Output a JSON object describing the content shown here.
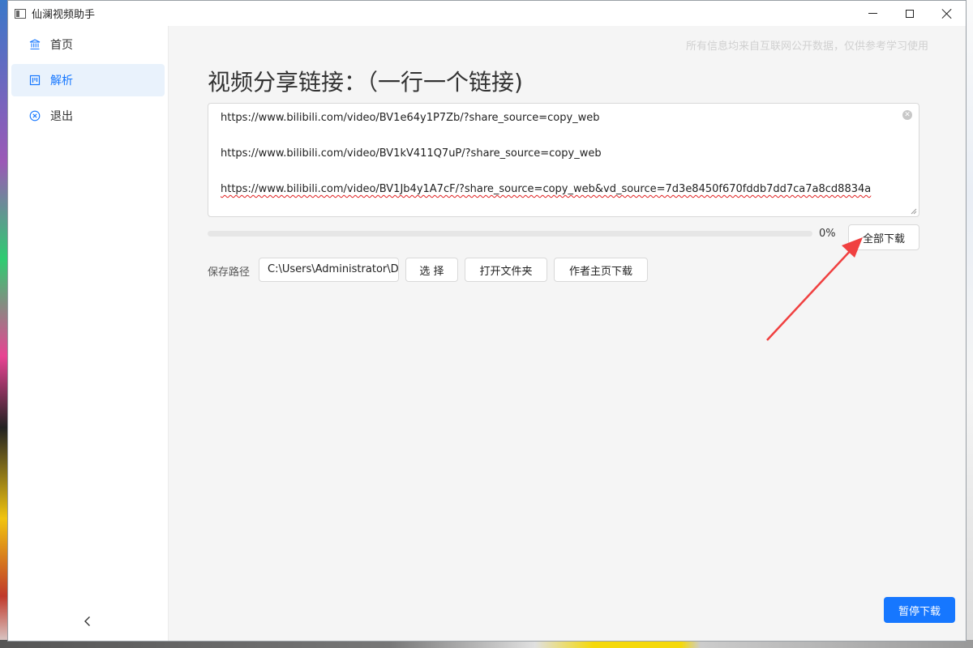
{
  "window": {
    "title": "仙澜视频助手"
  },
  "sidebar": {
    "items": [
      {
        "label": "首页",
        "icon": "bank-icon",
        "active": false
      },
      {
        "label": "解析",
        "icon": "project-icon",
        "active": true
      },
      {
        "label": "退出",
        "icon": "close-circle-icon",
        "active": false
      }
    ],
    "collapse_icon": "chevron-left-icon"
  },
  "main": {
    "notice": "所有信息均来自互联网公开数据，仅供参考学习使用",
    "heading": "视频分享链接：（一行一个链接)",
    "links": [
      "https://www.bilibili.com/video/BV1e64y1P7Zb/?share_source=copy_web",
      "https://www.bilibili.com/video/BV1kV411Q7uP/?share_source=copy_web",
      "https://www.bilibili.com/video/BV1Jb4y1A7cF/?share_source=copy_web&vd_source=7d3e8450f670fddb7dd7ca7a8cd8834a"
    ],
    "progress": {
      "value": 0,
      "text": "0%"
    },
    "download_all_label": "全部下载",
    "save_path_label": "保存路径",
    "save_path_value": "C:\\Users\\Administrator\\D",
    "choose_label": "选 择",
    "open_folder_label": "打开文件夹",
    "author_download_label": "作者主页下载",
    "pause_label": "暂停下载"
  },
  "colors": {
    "accent": "#1677ff",
    "annotation_arrow": "#f04040"
  }
}
